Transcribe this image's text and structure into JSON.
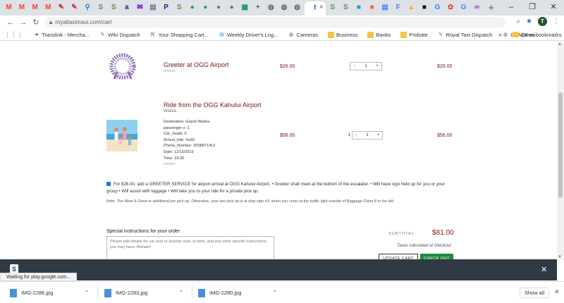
{
  "browser": {
    "tabs": [
      {
        "icon": "gmail-icon",
        "glyph": "M",
        "color": "#ea4335"
      },
      {
        "icon": "gmail-icon",
        "glyph": "M",
        "color": "#ea4335"
      },
      {
        "icon": "gmail-icon",
        "glyph": "M",
        "color": "#ea4335"
      },
      {
        "icon": "gmail-icon",
        "glyph": "M",
        "color": "#ea4335"
      },
      {
        "icon": "wiki-icon",
        "glyph": "✎",
        "color": "#c0392b"
      },
      {
        "icon": "wiki-icon",
        "glyph": "✎",
        "color": "#c0392b"
      },
      {
        "icon": "maps-pin-icon",
        "glyph": "⚲",
        "color": "#2a7ae2"
      },
      {
        "icon": "shopify-icon",
        "glyph": "S",
        "color": "#5e8e3e"
      },
      {
        "icon": "shopify-icon",
        "glyph": "S",
        "color": "#5e8e3e"
      },
      {
        "icon": "amazon-icon",
        "glyph": "a",
        "color": "#232f3e"
      },
      {
        "icon": "yahoo-mail-icon",
        "glyph": "✉",
        "color": "#6001d2"
      },
      {
        "icon": "document-icon",
        "glyph": "▤",
        "color": "#6b7b8c"
      },
      {
        "icon": "paypal-icon",
        "glyph": "P",
        "color": "#003087"
      },
      {
        "icon": "shopify-icon",
        "glyph": "S",
        "color": "#5e8e3e"
      },
      {
        "icon": "green-circle-icon",
        "glyph": "●",
        "color": "#3a9b4f"
      },
      {
        "icon": "green-circle-icon",
        "glyph": "●",
        "color": "#3a9b4f"
      },
      {
        "icon": "green-circle-icon",
        "glyph": "●",
        "color": "#3a9b4f"
      },
      {
        "icon": "green-circle-icon",
        "glyph": "●",
        "color": "#3a9b4f"
      },
      {
        "icon": "spreadsheet-icon",
        "glyph": "▦",
        "color": "#0f9d58"
      },
      {
        "icon": "plus-icon",
        "glyph": "+",
        "color": "#1a7f37"
      },
      {
        "icon": "globe-icon",
        "glyph": "◍",
        "color": "#666666"
      },
      {
        "icon": "globe-icon",
        "glyph": "◍",
        "color": "#666666"
      },
      {
        "icon": "globe-icon",
        "glyph": "◍",
        "color": "#666666"
      },
      {
        "icon": "facebook-icon",
        "glyph": "f",
        "color": "#1877f2",
        "active": true
      },
      {
        "icon": "shopify-icon",
        "glyph": "S",
        "color": "#5e8e3e"
      },
      {
        "icon": "shopify-icon",
        "glyph": "S",
        "color": "#5e8e3e"
      },
      {
        "icon": "windows-icon",
        "glyph": "■",
        "color": "#00a4ef"
      },
      {
        "icon": "orange-square-icon",
        "glyph": "■",
        "color": "#f06a35"
      },
      {
        "icon": "document-icon",
        "glyph": "▤",
        "color": "#4285f4"
      },
      {
        "icon": "doc-f-icon",
        "glyph": "F",
        "color": "#4285f4"
      },
      {
        "icon": "drive-icon",
        "glyph": "▲",
        "color": "#f4b400"
      },
      {
        "icon": "black-square-icon",
        "glyph": "■",
        "color": "#111111"
      },
      {
        "icon": "google-icon",
        "glyph": "G",
        "color": "#4285f4"
      },
      {
        "icon": "photos-icon",
        "glyph": "✿",
        "color": "#ea4335"
      },
      {
        "icon": "google-icon",
        "glyph": "G",
        "color": "#4285f4"
      },
      {
        "icon": "chart-icon",
        "glyph": "dlt",
        "color": "#6f42c1"
      }
    ],
    "active_tab_close": "×",
    "new_tab": "+",
    "window_controls": [
      "–",
      "❐",
      "✕"
    ],
    "url": "royaltaximaui.com/cart",
    "avatar_letter": "T"
  },
  "bookmarks": {
    "items": [
      {
        "icon": "translink-icon",
        "label": "Translink - Mercha..."
      },
      {
        "icon": "wiki-icon",
        "label": "Wiki Dispatch"
      },
      {
        "icon": "cart-icon",
        "label": "Your Shopping Cart..."
      },
      {
        "icon": "document-icon",
        "label": "Weekly Driver's Log..."
      },
      {
        "icon": "globe-icon",
        "label": "Cameras"
      },
      {
        "icon": "folder-icon",
        "label": "Business"
      },
      {
        "icon": "folder-icon",
        "label": "Banks"
      },
      {
        "icon": "folder-icon",
        "label": "Probate"
      },
      {
        "icon": "wiki-icon",
        "label": "Royal Taxi Dispatch"
      },
      {
        "icon": "globe-icon",
        "label": "GoAkamai"
      }
    ],
    "more": "»",
    "other": "Other bookmarks"
  },
  "cart": {
    "items": [
      {
        "title": "Greeter at OGG Airport",
        "remove": "remove",
        "price": "$26.00",
        "qty": "1",
        "line_total": "$26.00"
      },
      {
        "title": "Ride from the OGG Kahului Airport",
        "variant": "Wailea",
        "properties": [
          "Destination: Grand Wailea",
          "passenger s: 1",
          "Car_Seats: 0",
          "Arrival_Info: ha33",
          "Phone_Number: 3038871413",
          "Date: 11/13/2019",
          "Time: 23:30"
        ],
        "remove": "remove",
        "price": "$56.00",
        "qty": "1",
        "line_total": "$56.00"
      }
    ],
    "addon_text": "For $26.00, add a GREETER SERVICE for airport arrival at OGG Kahului Airport. • Greeter shall meet at the bottom of the escalator. • Will have sign held up for you or your group • Will assist with luggage • Will take you to your ride for a private pick up.",
    "note": "Note: The Meet & Greet is additional per pick up. Otherwise, your taxi pick up is at stop sign #3, when you cross at the traffic light outside of Baggage Claim 8 to the left.",
    "instructions_label": "Special instructions for your order",
    "instructions_placeholder": "Please add details for car seat or booster seat, or both, and any other specific instructions you may have. Mahalo!",
    "subtotal_label": "SUBTOTAL",
    "subtotal": "$81.00",
    "tax_note": "Taxes calculated at checkout",
    "update_label": "UPDATE CART",
    "checkout_label": "CHECK OUT"
  },
  "status_text": "Waiting for play.google.com...",
  "downloads": {
    "files": [
      "IMG-2286.jpg",
      "IMG-2283.jpg",
      "IMG-2280.jpg"
    ],
    "show_all": "Show all"
  }
}
